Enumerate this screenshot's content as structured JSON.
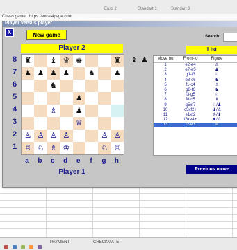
{
  "spreadsheet": {
    "columns": [
      "Euro 2",
      "Standart 1",
      "Standart 3"
    ],
    "name_box": "Chess game",
    "url_text": "https://excel4page.com",
    "sheet_tabs": [
      "PAYMENT",
      "CHECKMATE"
    ]
  },
  "window": {
    "title": "Player versus player"
  },
  "controls": {
    "close": "X",
    "new_game": "New game",
    "search_label": "Search:",
    "search_value": "",
    "list": "List",
    "previous_move": "Previous move"
  },
  "players": {
    "top": "Player 2",
    "bottom": "Player 1"
  },
  "ranks": [
    "8",
    "7",
    "6",
    "5",
    "4",
    "3",
    "2",
    "1"
  ],
  "files": [
    "a",
    "b",
    "c",
    "d",
    "e",
    "f",
    "g",
    "h"
  ],
  "board": [
    [
      "♜",
      "",
      "♝",
      "♛",
      "♚",
      "",
      "",
      "♜"
    ],
    [
      "♟",
      "♟",
      "♟",
      "♟",
      "",
      "♞",
      "",
      "♟"
    ],
    [
      "",
      "",
      "♞",
      "",
      "",
      "",
      "",
      ""
    ],
    [
      "",
      "",
      "",
      "",
      "♟",
      "",
      "",
      ""
    ],
    [
      "",
      "",
      "♗",
      "",
      "♟",
      "",
      "",
      ""
    ],
    [
      "",
      "",
      "",
      "",
      "♕",
      "",
      "",
      ""
    ],
    [
      "♙",
      "♙",
      "♙",
      "♙",
      "",
      "",
      "♙",
      "♙"
    ],
    [
      "♖",
      "♘",
      "♗",
      "♔",
      "",
      "",
      "♘",
      "♖"
    ]
  ],
  "captured": [
    "♝",
    "♟"
  ],
  "move_table": {
    "headers": [
      "Move no",
      "From-to",
      "Figure"
    ],
    "rows": [
      [
        "1",
        "e2-e4",
        "♙"
      ],
      [
        "2",
        "e7-e5",
        "♟"
      ],
      [
        "3",
        "g1-f3",
        "♘"
      ],
      [
        "4",
        "b8-c6",
        "♞"
      ],
      [
        "5",
        "f1-c4",
        "♗"
      ],
      [
        "6",
        "g8-f6",
        "♞"
      ],
      [
        "7",
        "f3-g5",
        "♘"
      ],
      [
        "8",
        "f8-c5",
        "♝"
      ],
      [
        "9",
        "g5xf7",
        "♘/♟"
      ],
      [
        "10",
        "c5xf2+",
        "♝/♙"
      ],
      [
        "11",
        "e1xf2",
        "♔/♝"
      ],
      [
        "12",
        "f6xe4+",
        "♞/♙"
      ],
      [
        "13",
        "f2-e3",
        "♔"
      ]
    ],
    "selected_row": 13
  },
  "colors": {
    "accent": "#ffff00",
    "label": "#1a1a8c",
    "button": "#00008b",
    "selection": "#3a6ad1"
  }
}
